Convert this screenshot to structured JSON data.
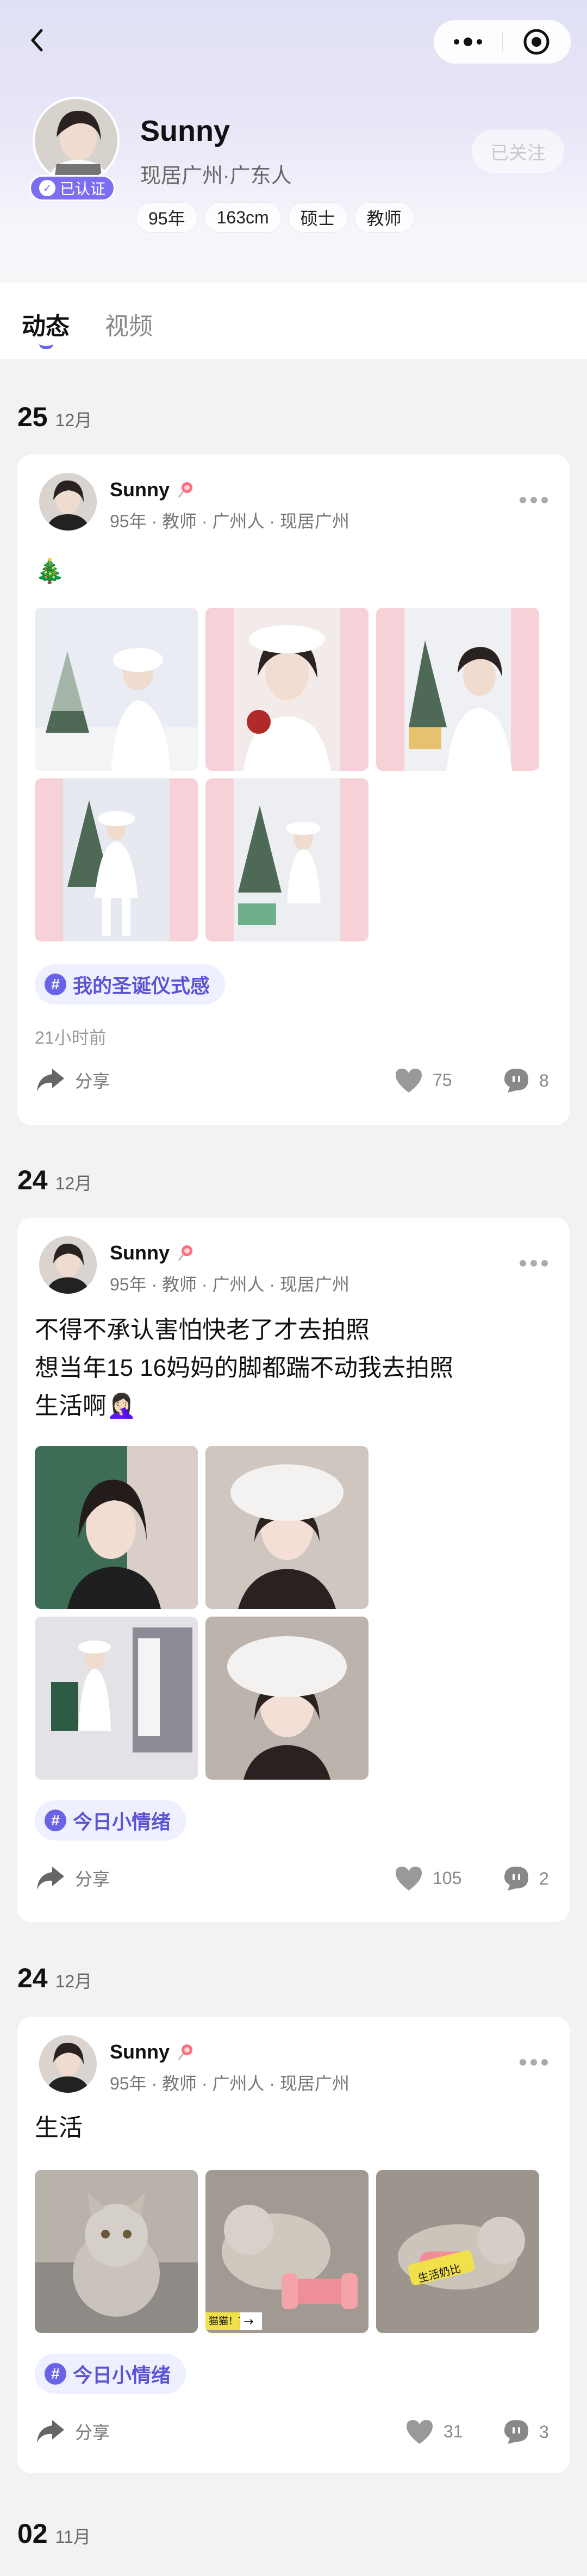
{
  "profile": {
    "name": "Sunny",
    "location": "现居广州·广东人",
    "verified_label": "已认证",
    "follow_label": "已关注",
    "tags": [
      "95年",
      "163cm",
      "硕士",
      "教师"
    ]
  },
  "tabs": [
    {
      "label": "动态",
      "active": true
    },
    {
      "label": "视频",
      "active": false
    }
  ],
  "posts": [
    {
      "date_day": "25",
      "date_month": "12月",
      "author": "Sunny",
      "meta": "95年 · 教师 · 广州人 · 现居广州",
      "text_lines": [
        "🎄"
      ],
      "topic": "我的圣诞仪式感",
      "time_ago": "21小时前",
      "share_label": "分享",
      "likes": "75",
      "comments": "8",
      "photo_count": 5
    },
    {
      "date_day": "24",
      "date_month": "12月",
      "author": "Sunny",
      "meta": "95年 · 教师 · 广州人 · 现居广州",
      "text_lines": [
        "不得不承认害怕快老了才去拍照",
        "想当年15 16妈妈的脚都踹不动我去拍照",
        "生活啊🤦🏻‍♀️"
      ],
      "topic": "今日小情绪",
      "share_label": "分享",
      "likes": "105",
      "comments": "2",
      "photo_count": 4
    },
    {
      "date_day": "24",
      "date_month": "12月",
      "author": "Sunny",
      "meta": "95年 · 教师 · 广州人 · 现居广州",
      "text_lines": [
        "生活"
      ],
      "topic": "今日小情绪",
      "share_label": "分享",
      "likes": "31",
      "comments": "3",
      "photo_count": 3,
      "photo_captions": [
        "猫猫！？",
        "生活奶比"
      ]
    }
  ],
  "next_date": {
    "day": "02",
    "month": "11月"
  },
  "colors": {
    "accent": "#6a63e8",
    "verified": "#7b6ef0",
    "topic_bg": "#eef0ff"
  },
  "icons": [
    "back-icon",
    "more-dots-icon",
    "target-icon",
    "share-icon",
    "heart-icon",
    "comment-icon",
    "hashtag-icon",
    "lollipop-icon",
    "verified-icon"
  ]
}
